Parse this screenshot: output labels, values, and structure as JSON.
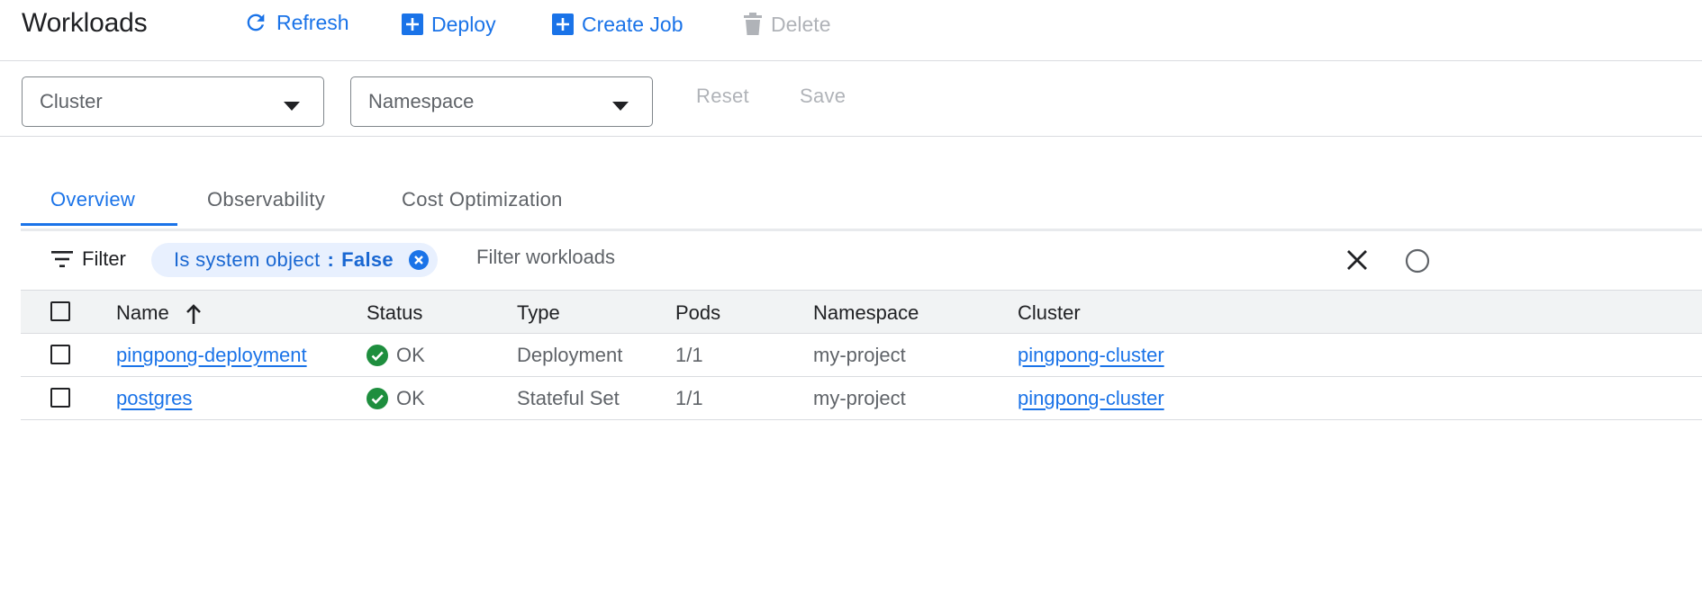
{
  "header": {
    "title": "Workloads",
    "actions": {
      "refresh": "Refresh",
      "deploy": "Deploy",
      "create_job": "Create Job",
      "delete": "Delete"
    }
  },
  "selectors": {
    "cluster": "Cluster",
    "namespace": "Namespace",
    "reset": "Reset",
    "save": "Save"
  },
  "tabs": [
    {
      "label": "Overview",
      "active": true
    },
    {
      "label": "Observability",
      "active": false
    },
    {
      "label": "Cost Optimization",
      "active": false
    }
  ],
  "filter": {
    "label": "Filter",
    "chip": {
      "key": "Is system object",
      "separator": ":",
      "value": "False"
    },
    "placeholder": "Filter workloads"
  },
  "table": {
    "columns": {
      "name": "Name",
      "status": "Status",
      "type": "Type",
      "pods": "Pods",
      "namespace": "Namespace",
      "cluster": "Cluster"
    },
    "sort": {
      "column": "Name",
      "direction": "ascending"
    },
    "rows": [
      {
        "name": "pingpong-deployment",
        "status": "OK",
        "type": "Deployment",
        "pods": "1/1",
        "namespace": "my-project",
        "cluster": "pingpong-cluster"
      },
      {
        "name": "postgres",
        "status": "OK",
        "type": "Stateful Set",
        "pods": "1/1",
        "namespace": "my-project",
        "cluster": "pingpong-cluster"
      }
    ]
  },
  "colors": {
    "accent": "#1a73e8",
    "status_ok": "#1e8e3e",
    "disabled": "#b0b3b8",
    "chip_bg": "#e8f0fe"
  },
  "icons": {
    "refresh": "refresh-icon",
    "deploy": "add-box-icon",
    "create_job": "add-box-icon",
    "delete": "trash-icon",
    "filter": "filter-list-icon",
    "chip_remove": "cancel-circle-icon",
    "clear": "close-icon",
    "sort": "arrow-up-icon",
    "status_ok": "check-circle-icon"
  }
}
